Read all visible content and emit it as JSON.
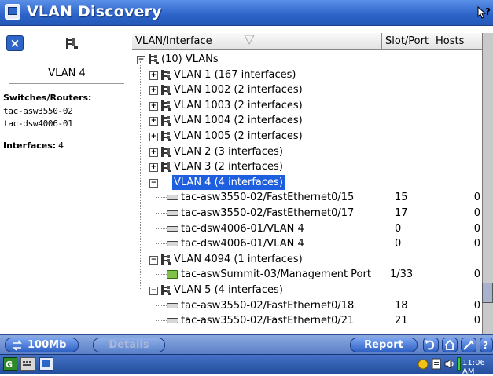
{
  "window": {
    "title": "VLAN Discovery",
    "help_glyph": "?"
  },
  "left_panel": {
    "close_glyph": "×",
    "vlan_name": "VLAN 4",
    "switches_label": "Switches/Routers:",
    "switches": [
      "tac-asw3550-02",
      "tac-dsw4006-01"
    ],
    "interfaces_label": "Interfaces:",
    "interfaces_count": "4"
  },
  "table": {
    "columns": [
      {
        "label": "VLAN/Interface"
      },
      {
        "label": "Slot/Port"
      },
      {
        "label": "Hosts"
      }
    ],
    "rows": [
      {
        "text": "(10) VLANs",
        "expander": "−",
        "icon": "network-icon",
        "level": 0,
        "slot": "",
        "hosts": ""
      },
      {
        "text": "VLAN 1 (167 interfaces)",
        "expander": "+",
        "icon": "network-icon",
        "level": 1,
        "slot": "",
        "hosts": ""
      },
      {
        "text": "VLAN 1002 (2 interfaces)",
        "expander": "+",
        "icon": "network-icon",
        "level": 1,
        "slot": "",
        "hosts": ""
      },
      {
        "text": "VLAN 1003 (2 interfaces)",
        "expander": "+",
        "icon": "network-icon",
        "level": 1,
        "slot": "",
        "hosts": ""
      },
      {
        "text": "VLAN 1004 (2 interfaces)",
        "expander": "+",
        "icon": "network-icon",
        "level": 1,
        "slot": "",
        "hosts": ""
      },
      {
        "text": "VLAN 1005 (2 interfaces)",
        "expander": "+",
        "icon": "network-icon",
        "level": 1,
        "slot": "",
        "hosts": ""
      },
      {
        "text": "VLAN 2 (3 interfaces)",
        "expander": "+",
        "icon": "network-icon",
        "level": 1,
        "slot": "",
        "hosts": ""
      },
      {
        "text": "VLAN 3 (2 interfaces)",
        "expander": "+",
        "icon": "network-icon",
        "level": 1,
        "slot": "",
        "hosts": ""
      },
      {
        "text": "VLAN 4 (4 interfaces)",
        "expander": "−",
        "icon": "network-icon",
        "level": 1,
        "slot": "",
        "hosts": "",
        "selected": true
      },
      {
        "text": "tac-asw3550-02/FastEthernet0/15",
        "expander": "",
        "icon": "port-icon",
        "level": 2,
        "slot": "15",
        "hosts": "0"
      },
      {
        "text": "tac-asw3550-02/FastEthernet0/17",
        "expander": "",
        "icon": "port-icon",
        "level": 2,
        "slot": "17",
        "hosts": "0"
      },
      {
        "text": "tac-dsw4006-01/VLAN 4",
        "expander": "",
        "icon": "port-icon",
        "level": 2,
        "slot": "0",
        "hosts": "0"
      },
      {
        "text": "tac-dsw4006-01/VLAN 4",
        "expander": "",
        "icon": "port-icon",
        "level": 2,
        "slot": "0",
        "hosts": "0"
      },
      {
        "text": "VLAN 4094 (1 interfaces)",
        "expander": "−",
        "icon": "network-icon",
        "level": 1,
        "slot": "",
        "hosts": ""
      },
      {
        "text": "tac-aswSummit-03/Management Port",
        "expander": "",
        "icon": "management-port-icon",
        "level": 2,
        "slot": "1/33",
        "hosts": "0"
      },
      {
        "text": "VLAN 5 (4 interfaces)",
        "expander": "−",
        "icon": "network-icon",
        "level": 1,
        "slot": "",
        "hosts": ""
      },
      {
        "text": "tac-asw3550-02/FastEthernet0/18",
        "expander": "",
        "icon": "port-icon",
        "level": 2,
        "slot": "18",
        "hosts": "0"
      },
      {
        "text": "tac-asw3550-02/FastEthernet0/21",
        "expander": "",
        "icon": "port-icon",
        "level": 2,
        "slot": "21",
        "hosts": "0"
      }
    ]
  },
  "toolbar": {
    "speed_label": "100Mb",
    "details_label": "Details",
    "report_label": "Report"
  },
  "taskbar": {
    "clock": "11:06 AM"
  },
  "colors": {
    "title_bar": "#2c63c8",
    "selection": "#1e5fe0",
    "toolbar": "#5b7fc8"
  }
}
